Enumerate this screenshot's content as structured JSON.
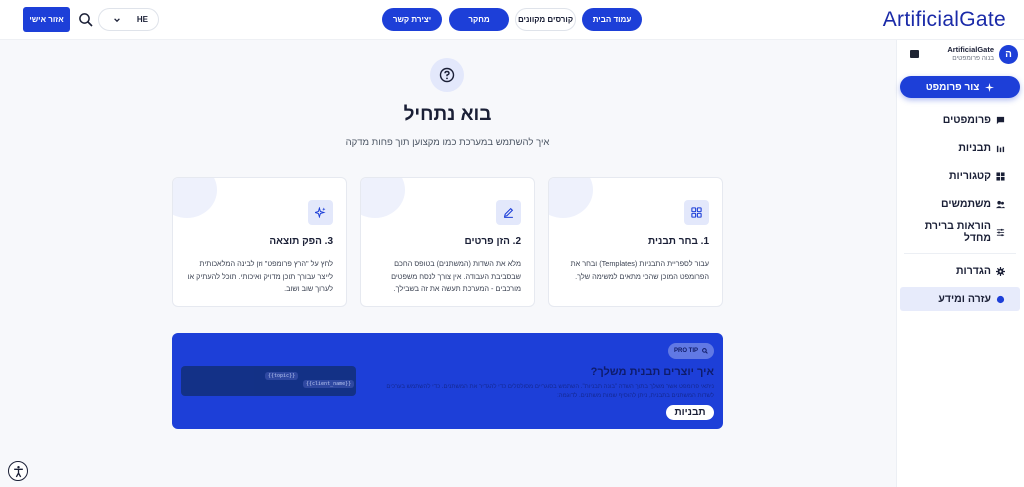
{
  "header": {
    "logo": "ArtificialGate",
    "nav": [
      {
        "label": "עמוד הבית",
        "variant": "primary"
      },
      {
        "label": "קורסים מקוונים",
        "variant": "ghost"
      },
      {
        "label": "מחקר",
        "variant": "primary"
      },
      {
        "label": "יצירת קשר",
        "variant": "primary"
      }
    ],
    "personal_area": "אזור אישי",
    "language": "HE"
  },
  "sidebar": {
    "brand_name": "ArtificialGate",
    "brand_subtitle": "בנוה פרומפטים",
    "avatar_letter": "ה",
    "create_button": "צור פרומפט",
    "items": [
      {
        "label": "פרומפטים",
        "icon": "chat-icon"
      },
      {
        "label": "תבניות",
        "icon": "bars-icon"
      },
      {
        "label": "קטגוריות",
        "icon": "grid-icon"
      },
      {
        "label": "משתמשים",
        "icon": "users-icon"
      },
      {
        "label": "הוראות ברירת מחדל",
        "icon": "sliders-icon"
      },
      {
        "label": "הגדרות",
        "icon": "gear-icon"
      },
      {
        "label": "עזרה ומידע",
        "icon": "dot-icon",
        "active": true
      }
    ]
  },
  "hero": {
    "title": "בוא נתחיל",
    "subtitle": "איך להשתמש במערכת כמו מקצוען תוך פחות מדקה"
  },
  "steps": [
    {
      "title": "1. בחר תבנית",
      "icon": "grid-icon",
      "text": "עבור לספריית התבניות (Templates) ובחר את הפרומפט המוכן שהכי מתאים למשימה שלך."
    },
    {
      "title": "2. הזן פרטים",
      "icon": "pencil-icon",
      "text": "מלא את השדות (המשתנים) בטופס החכם שבסביבת העבודה. אין צורך לנסח משפטים מורכבים - המערכת תעשה את זה בשבילך."
    },
    {
      "title": "3. הפק תוצאה",
      "icon": "sparkle-icon",
      "text": "לחץ על \"הרץ פרומפט\" וזן לבינה המלאכותית לייצר עבורך תוכן מדויק ואיכותי. תוכל להעתיק או לערוך שוב ושוב."
    }
  ],
  "pro_tip": {
    "badge": "PRO TIP",
    "title": "איך יוצרים תבנית משלך?",
    "text": "ניתאי פרומפט אשר משלך בתוך השדה \"בונה תבניות\". השתמש בסוגריים מסולסלים כדי להגדיר את המשתנים. כדי להשתמש בערכים לשדות המשתנים בתבנית, ניתן להוסיף שמות משתנים. לדוגמה:",
    "button": "תבניות",
    "code_var_1": "{{topic}}",
    "code_var_2": "{{client_name}}"
  },
  "colors": {
    "accent": "#1d3fd8",
    "accent_soft": "#e3e8fb",
    "background": "#f7f8fb"
  }
}
